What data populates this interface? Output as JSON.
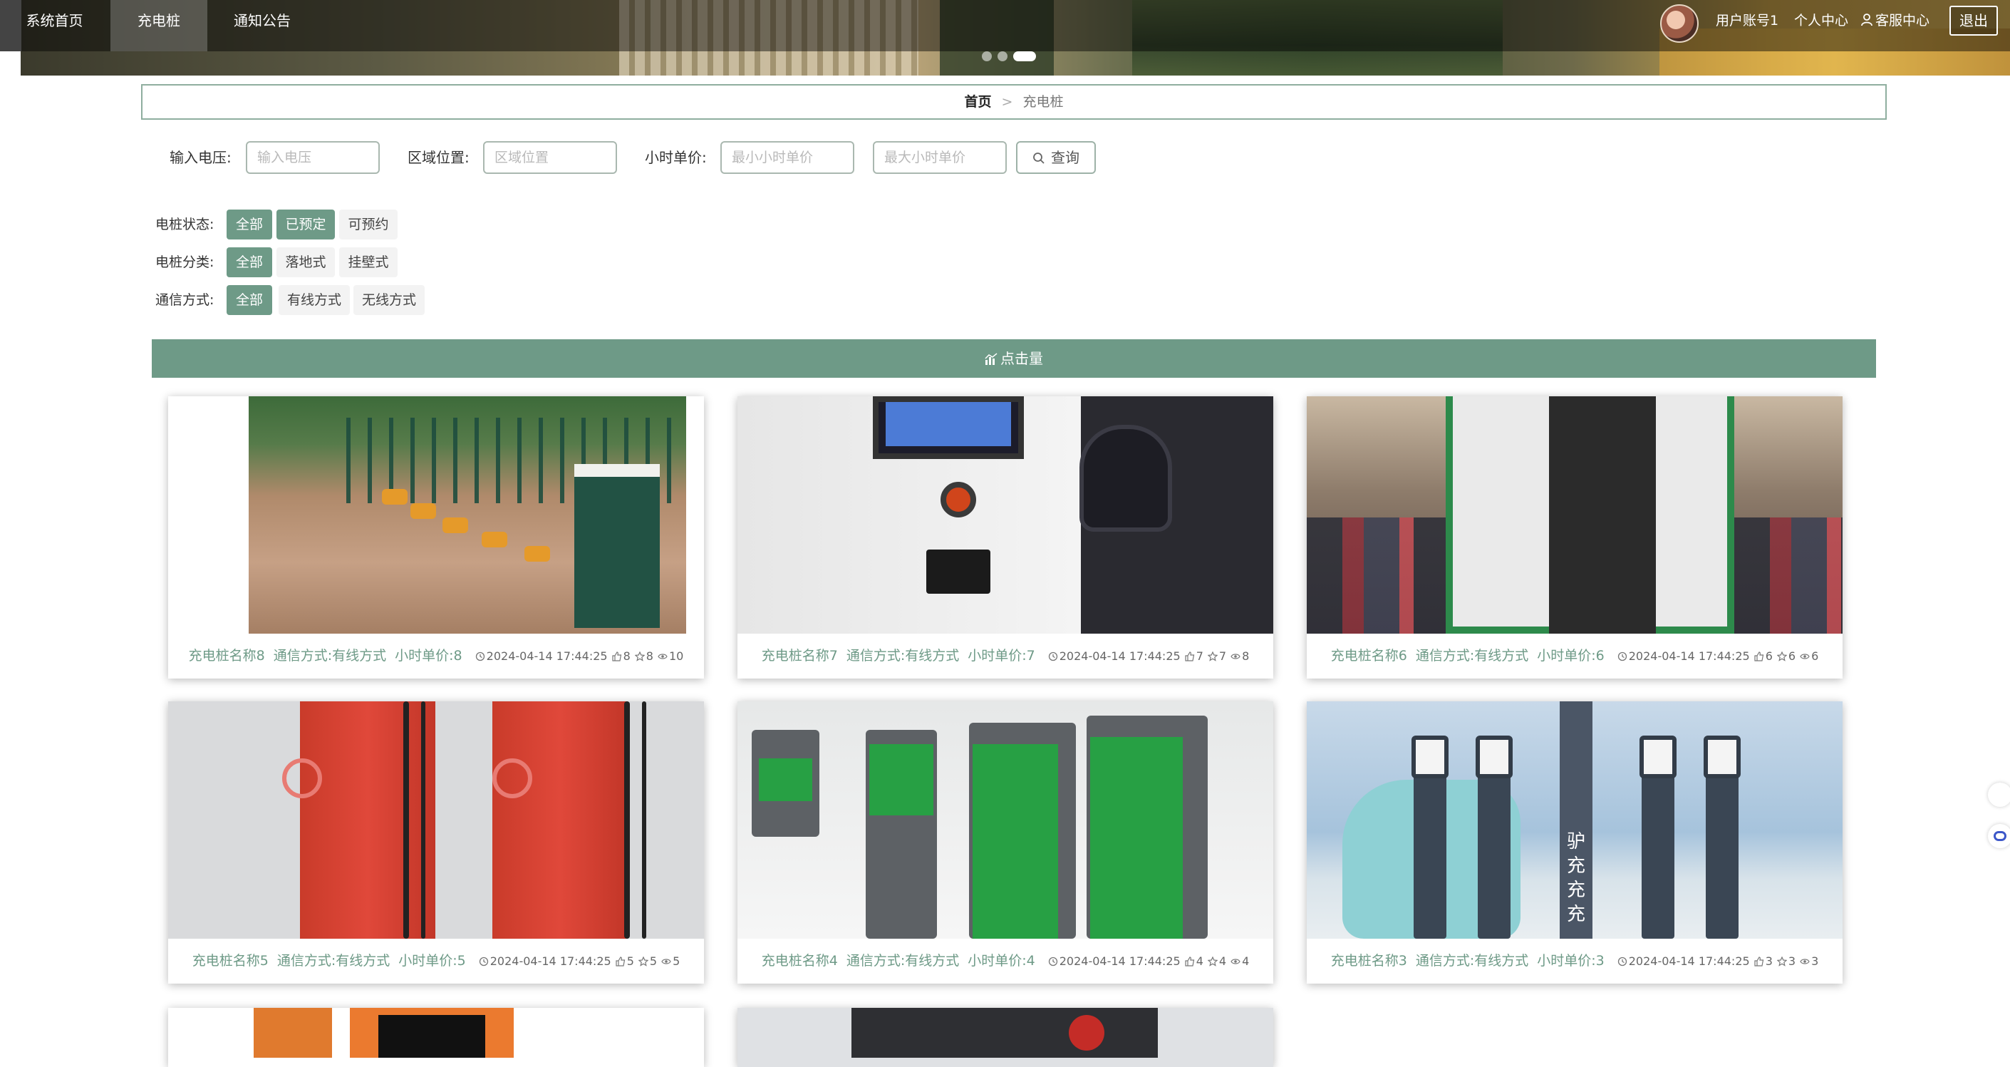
{
  "nav": {
    "items": [
      {
        "label": "系统首页"
      },
      {
        "label": "充电桩"
      },
      {
        "label": "通知公告"
      }
    ],
    "active_index": 1
  },
  "carousel": {
    "count": 3,
    "active": 3
  },
  "user": {
    "account": "用户账号1",
    "center": "个人中心",
    "service": "客服中心",
    "logout": "退出"
  },
  "breadcrumb": {
    "home": "首页",
    "separator": ">",
    "current": "充电桩"
  },
  "search": {
    "voltage_label": "输入电压:",
    "voltage_placeholder": "输入电压",
    "area_label": "区域位置:",
    "area_placeholder": "区域位置",
    "price_label": "小时单价:",
    "min_price_placeholder": "最小小时单价",
    "max_price_placeholder": "最大小时单价",
    "button_label": "查询"
  },
  "filters": [
    {
      "label": "电桩状态:",
      "options": [
        "全部",
        "已预定",
        "可预约"
      ],
      "selected": [
        0,
        1
      ]
    },
    {
      "label": "电桩分类:",
      "options": [
        "全部",
        "落地式",
        "挂壁式"
      ],
      "selected": [
        0
      ]
    },
    {
      "label": "通信方式:",
      "options": [
        "全部",
        "有线方式",
        "无线方式"
      ],
      "selected": [
        0
      ]
    }
  ],
  "section": {
    "title": "点击量"
  },
  "cards": [
    {
      "name": "充电桩名称8",
      "comm": "通信方式:有线方式",
      "price": "小时单价:8",
      "time": "2024-04-14 17:44:25",
      "likes": "8",
      "favs": "8",
      "views": "10"
    },
    {
      "name": "充电桩名称7",
      "comm": "通信方式:有线方式",
      "price": "小时单价:7",
      "time": "2024-04-14 17:44:25",
      "likes": "7",
      "favs": "7",
      "views": "8"
    },
    {
      "name": "充电桩名称6",
      "comm": "通信方式:有线方式",
      "price": "小时单价:6",
      "time": "2024-04-14 17:44:25",
      "likes": "6",
      "favs": "6",
      "views": "6"
    },
    {
      "name": "充电桩名称5",
      "comm": "通信方式:有线方式",
      "price": "小时单价:5",
      "time": "2024-04-14 17:44:25",
      "likes": "5",
      "favs": "5",
      "views": "5"
    },
    {
      "name": "充电桩名称4",
      "comm": "通信方式:有线方式",
      "price": "小时单价:4",
      "time": "2024-04-14 17:44:25",
      "likes": "4",
      "favs": "4",
      "views": "4"
    },
    {
      "name": "充电桩名称3",
      "comm": "通信方式:有线方式",
      "price": "小时单价:3",
      "time": "2024-04-14 17:44:25",
      "likes": "3",
      "favs": "3",
      "views": "3"
    }
  ],
  "picture_texts": {
    "card3_vertical": "驴充充充"
  },
  "colors": {
    "accent": "#6e9a87",
    "accent_border": "#8fae9f",
    "nav_overlay": "rgba(0,0,0,0.45)"
  },
  "icons": {
    "search": "search-icon",
    "section": "bar-chart-icon",
    "time": "clock-icon",
    "like": "thumbs-up-icon",
    "fav": "star-icon",
    "view": "eye-icon",
    "service": "user-icon"
  }
}
